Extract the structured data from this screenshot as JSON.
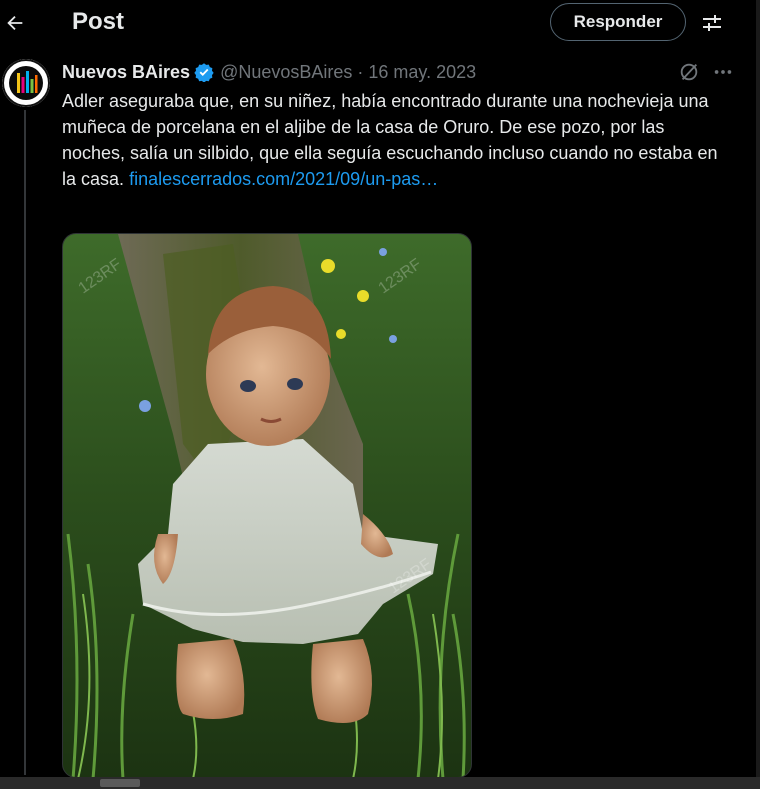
{
  "header": {
    "title": "Post",
    "reply_button": "Responder"
  },
  "post": {
    "author_name": "Nuevos BAires",
    "handle": "@NuevosBAires",
    "separator": "·",
    "date": "16 may. 2023",
    "text": "Adler aseguraba que, en su niñez, había encontrado durante una nochevieja una muñeca de porcelana en el aljibe de la casa de Oruro. De ese pozo, por las noches, salía un silbido, que ella seguía escuchando incluso cuando no estaba en la casa.",
    "link": "finalescerrados.com/2021/09/un-pas…"
  },
  "media": {
    "watermark": "123RF"
  },
  "colors": {
    "background": "#000000",
    "text": "#e7e9ea",
    "muted": "#71767b",
    "link": "#1d9bf0",
    "verified": "#1d9bf0"
  },
  "icons": {
    "back": "arrow-left-icon",
    "filter": "sliders-icon",
    "verified": "verified-badge-icon",
    "grok": "grok-icon",
    "more": "more-icon"
  }
}
